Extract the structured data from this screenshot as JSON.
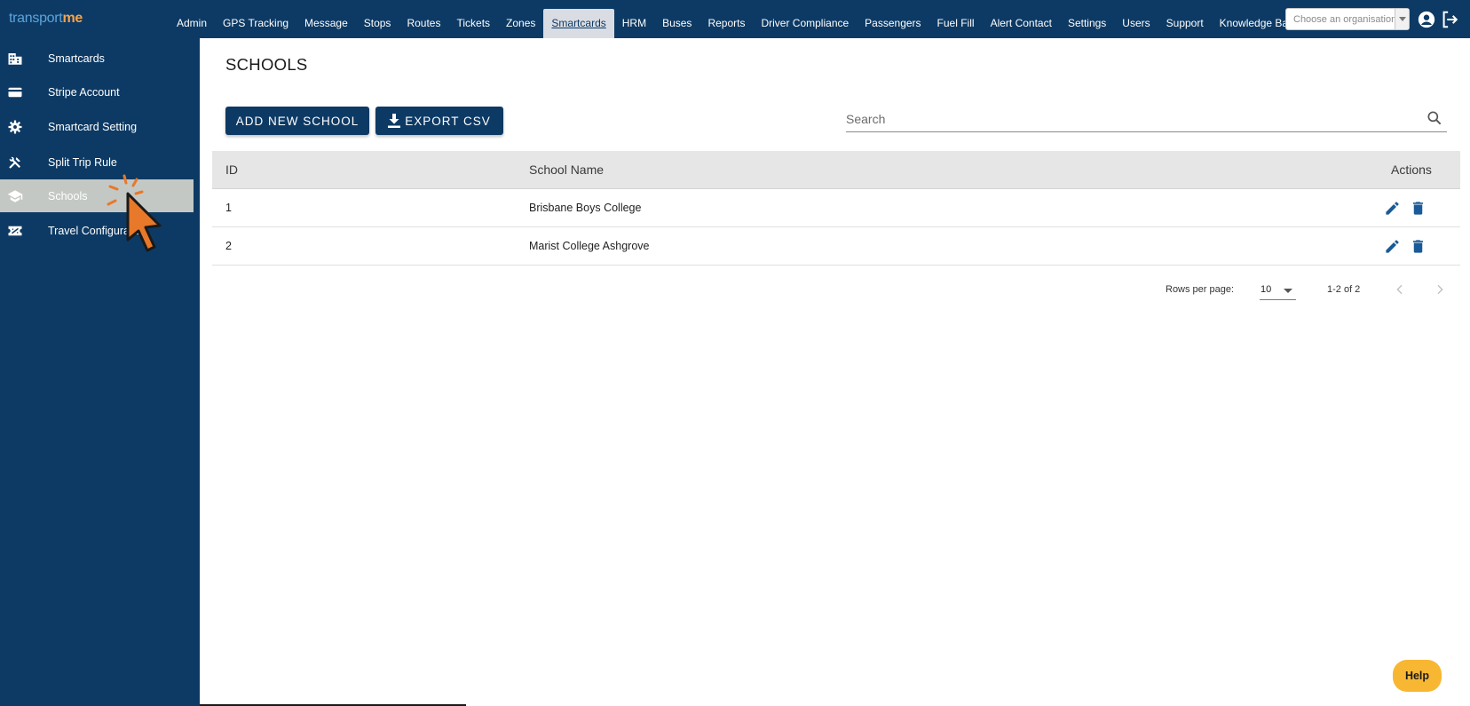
{
  "logo": {
    "part1": "transport",
    "part2": "me"
  },
  "nav": [
    {
      "label": "Admin"
    },
    {
      "label": "GPS Tracking"
    },
    {
      "label": "Message"
    },
    {
      "label": "Stops"
    },
    {
      "label": "Routes"
    },
    {
      "label": "Tickets"
    },
    {
      "label": "Zones"
    },
    {
      "label": "Smartcards",
      "active": true
    },
    {
      "label": "HRM"
    },
    {
      "label": "Buses"
    },
    {
      "label": "Reports"
    },
    {
      "label": "Driver Compliance"
    },
    {
      "label": "Passengers"
    },
    {
      "label": "Fuel Fill"
    },
    {
      "label": "Alert Contact"
    },
    {
      "label": "Settings"
    },
    {
      "label": "Users"
    },
    {
      "label": "Support"
    },
    {
      "label": "Knowledge Base"
    }
  ],
  "org_select": {
    "placeholder": "Choose an organisation"
  },
  "top_icons": [
    "account-circle-icon",
    "logout-icon"
  ],
  "sidebar": {
    "items": [
      {
        "label": "Smartcards",
        "icon": "building-icon"
      },
      {
        "label": "Stripe Account",
        "icon": "credit-card-icon"
      },
      {
        "label": "Smartcard Setting",
        "icon": "gear-icon"
      },
      {
        "label": "Split Trip Rule",
        "icon": "tools-icon"
      },
      {
        "label": "Schools",
        "icon": "graduation-cap-icon",
        "active": true
      },
      {
        "label": "Travel Configuratio",
        "icon": "ticket-icon"
      }
    ]
  },
  "main": {
    "title": "SCHOOLS",
    "add_button": "ADD NEW SCHOOL",
    "export_button": "EXPORT CSV",
    "search_placeholder": "Search"
  },
  "table": {
    "headers": {
      "id": "ID",
      "name": "School Name",
      "actions": "Actions"
    },
    "rows": [
      {
        "id": "1",
        "name": "Brisbane Boys College"
      },
      {
        "id": "2",
        "name": "Marist College Ashgrove"
      }
    ]
  },
  "pagination": {
    "rows_per_page_label": "Rows per page:",
    "rows_per_page": "10",
    "range": "1-2 of 2"
  },
  "help": {
    "label": "Help"
  },
  "colors": {
    "primary": "#0d3a64",
    "accent": "#f5a24a",
    "help": "#f7b733",
    "active_sidebar": "#c4c8c4"
  }
}
